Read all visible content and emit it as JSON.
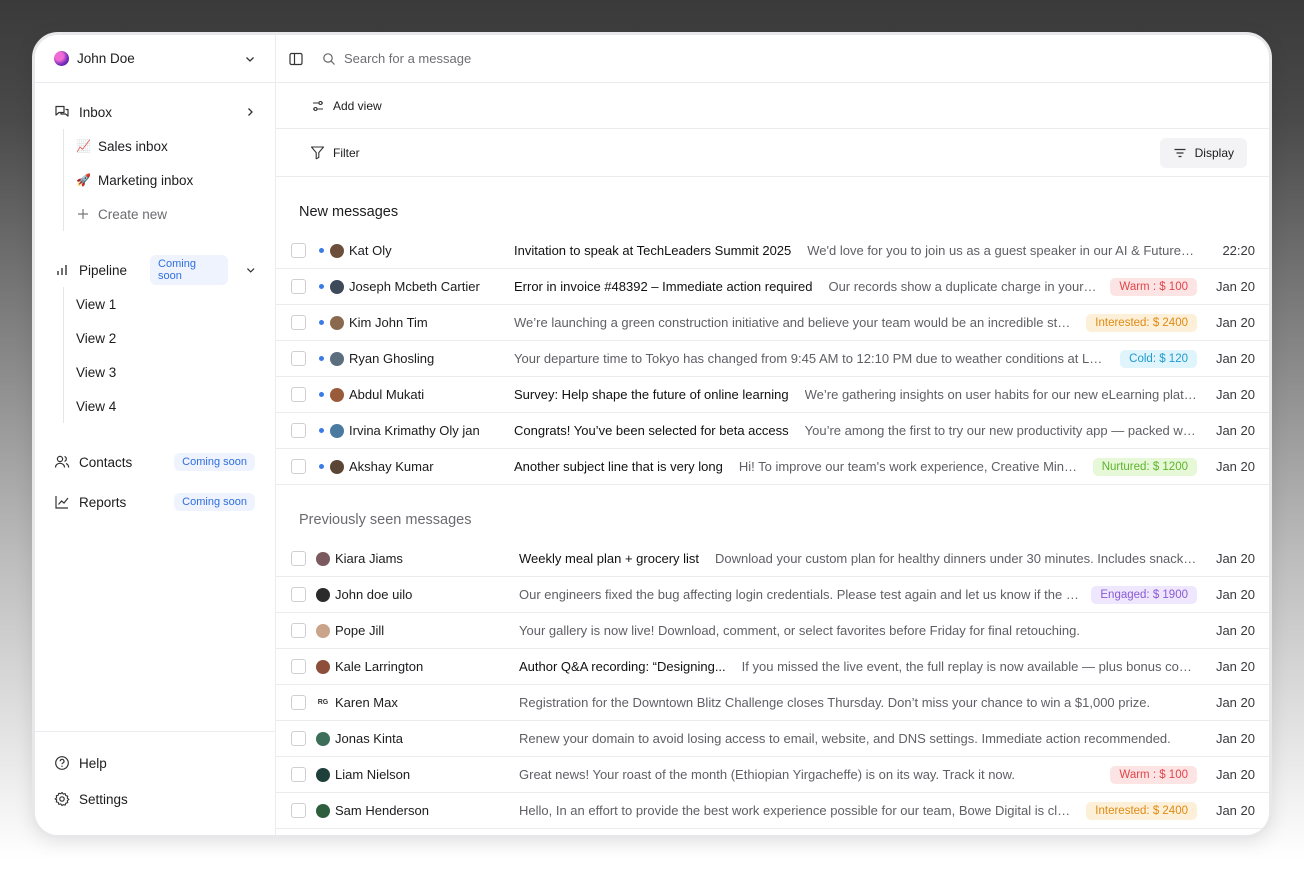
{
  "sidebar": {
    "user_name": "John Doe",
    "inbox_label": "Inbox",
    "inbox_items": [
      {
        "label": "Sales inbox",
        "icon": "📈"
      },
      {
        "label": "Marketing inbox",
        "icon": "🚀"
      }
    ],
    "create_new_label": "Create new",
    "pipeline_label": "Pipeline",
    "pipeline_badge": "Coming soon",
    "pipeline_views": [
      "View 1",
      "View 2",
      "View 3",
      "View 4"
    ],
    "contacts_label": "Contacts",
    "contacts_badge": "Coming soon",
    "reports_label": "Reports",
    "reports_badge": "Coming soon",
    "help_label": "Help",
    "settings_label": "Settings"
  },
  "search": {
    "placeholder": "Search for a message"
  },
  "toolbar": {
    "add_view_label": "Add view",
    "filter_label": "Filter",
    "display_label": "Display"
  },
  "new_messages": {
    "title": "New messages",
    "rows": [
      {
        "sender": "Kat Oly",
        "subject": "Invitation to speak at TechLeaders Summit 2025",
        "preview": "We'd love for you to join us as a guest speaker in our AI & Future Wo...",
        "tag": "",
        "date": "22:20"
      },
      {
        "sender": "Joseph Mcbeth Cartier",
        "subject": "Error in invoice #48392 – Immediate action required",
        "preview": "Our records show a duplicate charge in your la...",
        "tag": "Warm : $ 100",
        "date": "Jan 20"
      },
      {
        "sender": "Kim John Tim",
        "subject": "",
        "preview": "We’re launching a green construction initiative and believe your team would be an incredible strate...",
        "tag": "Interested: $ 2400",
        "date": "Jan 20"
      },
      {
        "sender": "Ryan Ghosling",
        "subject": "",
        "preview": "Your departure time to Tokyo has changed from 9:45 AM to 12:10 PM due to weather conditions at LAX.",
        "tag": "Cold: $ 120",
        "date": "Jan 20"
      },
      {
        "sender": "Abdul Mukati",
        "subject": "Survey: Help shape the future of online learning",
        "preview": "We’re gathering insights on user habits for our new eLearning platfo...",
        "tag": "",
        "date": "Jan 20"
      },
      {
        "sender": "Irvina Krimathy Oly jan",
        "subject": "Congrats! You’ve been selected for beta access",
        "preview": "You’re among the first to try our new productivity app — packed wit...",
        "tag": "",
        "date": "Jan 20"
      },
      {
        "sender": "Akshay Kumar",
        "subject": "Another subject line that is very long",
        "preview": "Hi! To improve our team's work experience, Creative Minds...",
        "tag": "Nurtured: $ 1200",
        "date": "Jan 20"
      }
    ]
  },
  "seen_messages": {
    "title": "Previously seen messages",
    "rows": [
      {
        "sender": "Kiara Jiams",
        "subject": "Weekly meal plan + grocery list",
        "preview": "Download your custom plan for healthy dinners under 30 minutes. Includes snacks a...",
        "tag": "",
        "date": "Jan 20"
      },
      {
        "sender": "John doe uilo",
        "subject": "",
        "preview": "Our engineers fixed the bug affecting login credentials. Please test again and let us know if the issue...",
        "tag": "Engaged: $ 1900",
        "date": "Jan 20"
      },
      {
        "sender": "Pope Jill",
        "subject": "",
        "preview": "Your gallery is now live! Download, comment, or select favorites before Friday for final retouching.",
        "tag": "",
        "date": "Jan 20"
      },
      {
        "sender": "Kale Larrington",
        "subject": "Author Q&A recording: “Designing...",
        "preview": "If you missed the live event, the full replay is now available — plus bonus comm...",
        "tag": "",
        "date": "Jan 20"
      },
      {
        "sender": "Karen Max",
        "avatar_text": "RG",
        "subject": "",
        "preview": "Registration for the Downtown Blitz Challenge closes Thursday. Don’t miss your chance to win a $1,000 prize.",
        "tag": "",
        "date": "Jan 20"
      },
      {
        "sender": "Jonas Kinta",
        "subject": "",
        "preview": "Renew your domain to avoid losing access to email, website, and DNS settings. Immediate action recommended.",
        "tag": "",
        "date": "Jan 20"
      },
      {
        "sender": "Liam Nielson",
        "subject": "",
        "preview": "Great news! Your roast of the month (Ethiopian Yirgacheffe) is on its way. Track it now.",
        "tag": "Warm : $ 100",
        "date": "Jan 20"
      },
      {
        "sender": "Sam Henderson",
        "subject": "",
        "preview": "Hello, In an effort to provide the best work experience possible for our team, Bowe Digital is closed o...",
        "tag": "Interested: $ 2400",
        "date": "Jan 20"
      }
    ]
  }
}
